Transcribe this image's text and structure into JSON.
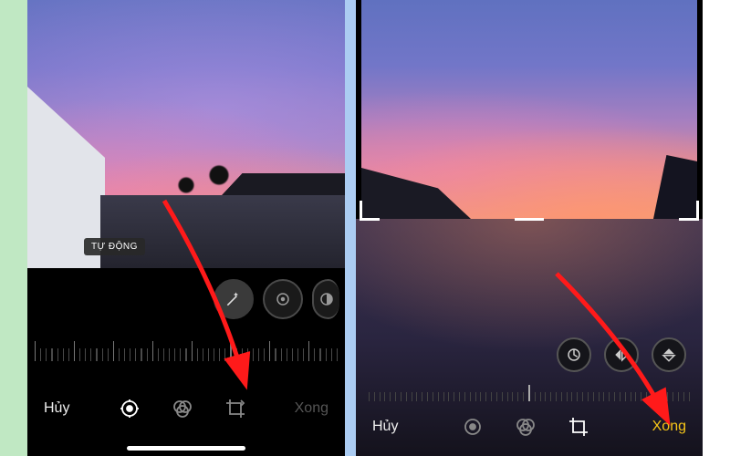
{
  "left": {
    "auto_label": "TỰ ĐỘNG",
    "toolbar": {
      "cancel": "Hủy",
      "done": "Xong"
    },
    "tool_icons": [
      "adjust",
      "filters",
      "crop"
    ],
    "dial_icons": [
      "wand",
      "exposure",
      "contrast"
    ]
  },
  "right": {
    "toolbar": {
      "cancel": "Hủy",
      "done": "Xong"
    },
    "tool_icons": [
      "adjust",
      "filters",
      "crop"
    ],
    "transform_icons": [
      "straighten",
      "flip-h",
      "flip-v"
    ]
  },
  "colors": {
    "accent": "#f5c518",
    "arrow": "#ff1a1a"
  }
}
